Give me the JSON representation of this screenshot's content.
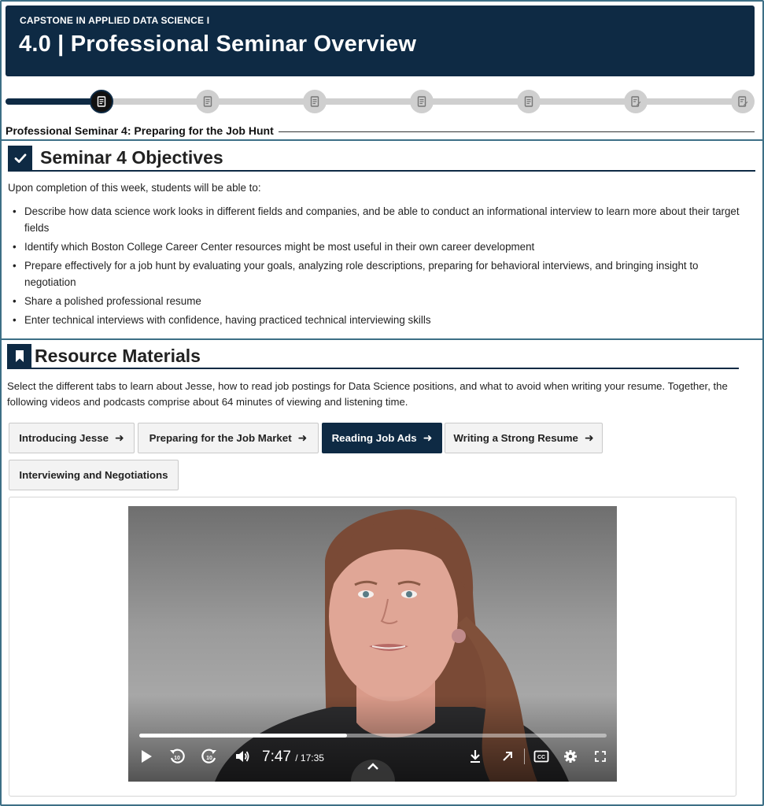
{
  "header": {
    "course": "CAPSTONE IN APPLIED DATA SCIENCE I",
    "title": "4.0 | Professional Seminar Overview"
  },
  "progress": {
    "current_step": 1,
    "total_steps": 7,
    "seminar_label": "Professional Seminar 4: Preparing for the Job Hunt"
  },
  "objectives": {
    "title": "Seminar 4 Objectives",
    "intro": "Upon completion of this week, students will be able to:",
    "items": [
      "Describe how data science work looks in different fields and companies, and be able to conduct an informational interview to learn more about their target fields",
      "Identify which Boston College Career Center resources might be most useful in their own career development",
      "Prepare effectively for a job hunt by evaluating your goals, analyzing role descriptions, preparing for behavioral interviews, and bringing insight to negotiation",
      "Share a polished professional resume",
      "Enter technical interviews with confidence, having practiced technical interviewing skills"
    ]
  },
  "resources": {
    "title": "Resource Materials",
    "description": "Select the different tabs to learn about Jesse, how to read job postings for Data Science positions, and what to avoid when writing your resume. Together, the following videos and podcasts comprise about 64 minutes of viewing and listening time.",
    "tabs": [
      {
        "label": "Introducing Jesse",
        "arrow": "➜"
      },
      {
        "label": "Preparing for the Job Market",
        "arrow": "➜"
      },
      {
        "label": "Reading Job Ads",
        "arrow": "➜"
      },
      {
        "label": "Writing a Strong Resume",
        "arrow": "➜"
      },
      {
        "label": "Interviewing and Negotiations"
      }
    ],
    "active_tab": "Reading Job Ads"
  },
  "player": {
    "current_time": "7:47",
    "duration": "/ 17:35",
    "played_fraction": 0.445
  },
  "colors": {
    "brand_navy": "#0e2a44",
    "border_teal": "#3d6f86"
  }
}
